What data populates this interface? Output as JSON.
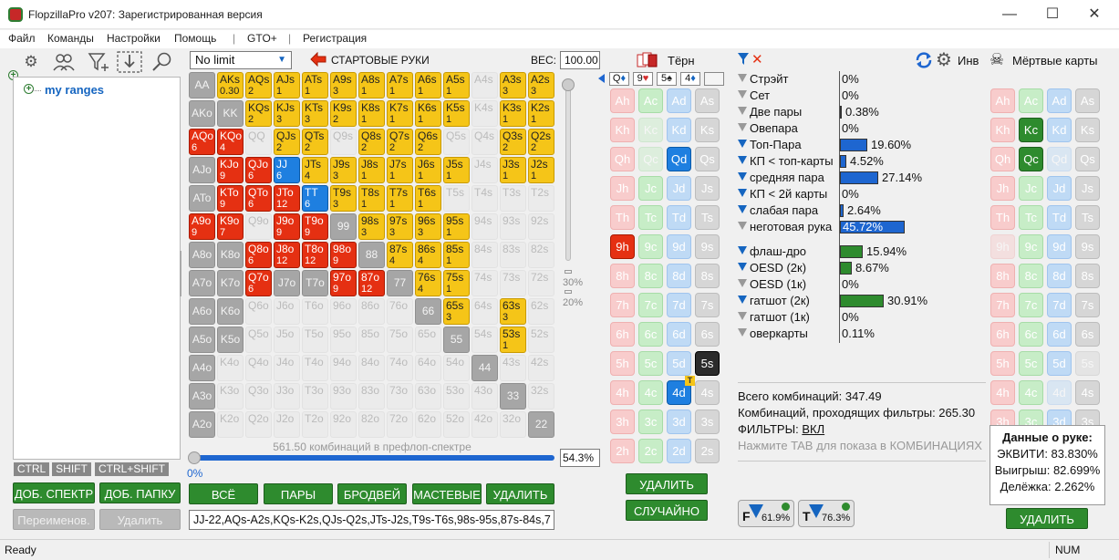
{
  "window": {
    "title": "FlopzillaPro v207: Зарегистрированная версия",
    "minimize_glyph": "—",
    "maximize_glyph": "☐",
    "close_glyph": "✕"
  },
  "menu": [
    "Файл",
    "Команды",
    "Настройки",
    "Помощь",
    "|",
    "GTO+",
    "|",
    "Регистрация"
  ],
  "left": {
    "tree_root": "my ranges",
    "key_buttons": [
      "CTRL",
      "SHIFT",
      "CTRL+SHIFT"
    ],
    "buttons": [
      "ДОБ. СПЕКТР",
      "ДОБ. ПАПКУ",
      "Переименов.",
      "Удалить"
    ]
  },
  "center": {
    "game_type": "No limit",
    "starting_hands_label": "СТАРТОВЫЕ РУКИ",
    "weight_label": "ВЕС:",
    "weight_value": "100.00",
    "slider_marks": [
      "30%",
      "20%"
    ],
    "combos_status": "561.50 комбинаций в префлоп-спектре",
    "range_percent": "54.3%",
    "slider_min": "0%",
    "buttons": [
      "ВСЁ",
      "ПАРЫ",
      "БРОДВЕЙ",
      "МАСТЕВЫЕ",
      "УДАЛИТЬ"
    ],
    "range_text": "JJ-22,AQs-A2s,KQs-K2s,QJs-Q2s,JTs-J2s,T9s-T6s,98s-95s,87s-84s,7",
    "grid": [
      [
        [
          "AA",
          "",
          "p"
        ],
        [
          "AKs",
          "0.30",
          "y"
        ],
        [
          "AQs",
          "2",
          "y"
        ],
        [
          "AJs",
          "1",
          "y"
        ],
        [
          "ATs",
          "1",
          "y"
        ],
        [
          "A9s",
          "3",
          "y"
        ],
        [
          "A8s",
          "1",
          "y"
        ],
        [
          "A7s",
          "1",
          "y"
        ],
        [
          "A6s",
          "1",
          "y"
        ],
        [
          "A5s",
          "1",
          "y"
        ],
        [
          "A4s",
          "",
          "e"
        ],
        [
          "A3s",
          "3",
          "y"
        ],
        [
          "A2s",
          "3",
          "y"
        ]
      ],
      [
        [
          "AKo",
          "",
          "p"
        ],
        [
          "KK",
          "",
          "p"
        ],
        [
          "KQs",
          "2",
          "y"
        ],
        [
          "KJs",
          "3",
          "y"
        ],
        [
          "KTs",
          "3",
          "y"
        ],
        [
          "K9s",
          "2",
          "y"
        ],
        [
          "K8s",
          "1",
          "y"
        ],
        [
          "K7s",
          "1",
          "y"
        ],
        [
          "K6s",
          "1",
          "y"
        ],
        [
          "K5s",
          "1",
          "y"
        ],
        [
          "K4s",
          "",
          "e"
        ],
        [
          "K3s",
          "1",
          "y"
        ],
        [
          "K2s",
          "1",
          "y"
        ]
      ],
      [
        [
          "AQo",
          "6",
          "r"
        ],
        [
          "KQo",
          "4",
          "r"
        ],
        [
          "QQ",
          "",
          "e"
        ],
        [
          "QJs",
          "2",
          "y"
        ],
        [
          "QTs",
          "2",
          "y"
        ],
        [
          "Q9s",
          "",
          "e"
        ],
        [
          "Q8s",
          "2",
          "y"
        ],
        [
          "Q7s",
          "2",
          "y"
        ],
        [
          "Q6s",
          "2",
          "y"
        ],
        [
          "Q5s",
          "",
          "e"
        ],
        [
          "Q4s",
          "",
          "e"
        ],
        [
          "Q3s",
          "2",
          "y"
        ],
        [
          "Q2s",
          "2",
          "y"
        ]
      ],
      [
        [
          "AJo",
          "",
          "p"
        ],
        [
          "KJo",
          "9",
          "r"
        ],
        [
          "QJo",
          "6",
          "r"
        ],
        [
          "JJ",
          "6",
          "b"
        ],
        [
          "JTs",
          "4",
          "y"
        ],
        [
          "J9s",
          "3",
          "y"
        ],
        [
          "J8s",
          "1",
          "y"
        ],
        [
          "J7s",
          "1",
          "y"
        ],
        [
          "J6s",
          "1",
          "y"
        ],
        [
          "J5s",
          "1",
          "y"
        ],
        [
          "J4s",
          "",
          "e"
        ],
        [
          "J3s",
          "1",
          "y"
        ],
        [
          "J2s",
          "1",
          "y"
        ]
      ],
      [
        [
          "ATo",
          "",
          "p"
        ],
        [
          "KTo",
          "9",
          "r"
        ],
        [
          "QTo",
          "6",
          "r"
        ],
        [
          "JTo",
          "12",
          "r"
        ],
        [
          "TT",
          "6",
          "b"
        ],
        [
          "T9s",
          "3",
          "y"
        ],
        [
          "T8s",
          "1",
          "y"
        ],
        [
          "T7s",
          "1",
          "y"
        ],
        [
          "T6s",
          "1",
          "y"
        ],
        [
          "T5s",
          "",
          "e"
        ],
        [
          "T4s",
          "",
          "e"
        ],
        [
          "T3s",
          "",
          "e"
        ],
        [
          "T2s",
          "",
          "e"
        ]
      ],
      [
        [
          "A9o",
          "9",
          "r"
        ],
        [
          "K9o",
          "7",
          "r"
        ],
        [
          "Q9o",
          "",
          "e"
        ],
        [
          "J9o",
          "9",
          "r"
        ],
        [
          "T9o",
          "9",
          "r"
        ],
        [
          "99",
          "",
          "p"
        ],
        [
          "98s",
          "3",
          "y"
        ],
        [
          "97s",
          "3",
          "y"
        ],
        [
          "96s",
          "3",
          "y"
        ],
        [
          "95s",
          "1",
          "y"
        ],
        [
          "94s",
          "",
          "e"
        ],
        [
          "93s",
          "",
          "e"
        ],
        [
          "92s",
          "",
          "e"
        ]
      ],
      [
        [
          "A8o",
          "",
          "p"
        ],
        [
          "K8o",
          "",
          "p"
        ],
        [
          "Q8o",
          "6",
          "r"
        ],
        [
          "J8o",
          "12",
          "r"
        ],
        [
          "T8o",
          "12",
          "r"
        ],
        [
          "98o",
          "9",
          "r"
        ],
        [
          "88",
          "",
          "p"
        ],
        [
          "87s",
          "4",
          "y"
        ],
        [
          "86s",
          "4",
          "y"
        ],
        [
          "85s",
          "1",
          "y"
        ],
        [
          "84s",
          "",
          "e"
        ],
        [
          "83s",
          "",
          "e"
        ],
        [
          "82s",
          "",
          "e"
        ]
      ],
      [
        [
          "A7o",
          "",
          "p"
        ],
        [
          "K7o",
          "",
          "p"
        ],
        [
          "Q7o",
          "6",
          "r"
        ],
        [
          "J7o",
          "",
          "p"
        ],
        [
          "T7o",
          "",
          "p"
        ],
        [
          "97o",
          "9",
          "r"
        ],
        [
          "87o",
          "12",
          "r"
        ],
        [
          "77",
          "",
          "p"
        ],
        [
          "76s",
          "4",
          "y"
        ],
        [
          "75s",
          "1",
          "y"
        ],
        [
          "74s",
          "",
          "e"
        ],
        [
          "73s",
          "",
          "e"
        ],
        [
          "72s",
          "",
          "e"
        ]
      ],
      [
        [
          "A6o",
          "",
          "p"
        ],
        [
          "K6o",
          "",
          "p"
        ],
        [
          "Q6o",
          "",
          "e"
        ],
        [
          "J6o",
          "",
          "e"
        ],
        [
          "T6o",
          "",
          "e"
        ],
        [
          "96o",
          "",
          "e"
        ],
        [
          "86o",
          "",
          "e"
        ],
        [
          "76o",
          "",
          "e"
        ],
        [
          "66",
          "",
          "p"
        ],
        [
          "65s",
          "3",
          "y"
        ],
        [
          "64s",
          "",
          "e"
        ],
        [
          "63s",
          "3",
          "y"
        ],
        [
          "62s",
          "",
          "e"
        ]
      ],
      [
        [
          "A5o",
          "",
          "p"
        ],
        [
          "K5o",
          "",
          "p"
        ],
        [
          "Q5o",
          "",
          "e"
        ],
        [
          "J5o",
          "",
          "e"
        ],
        [
          "T5o",
          "",
          "e"
        ],
        [
          "95o",
          "",
          "e"
        ],
        [
          "85o",
          "",
          "e"
        ],
        [
          "75o",
          "",
          "e"
        ],
        [
          "65o",
          "",
          "e"
        ],
        [
          "55",
          "",
          "p"
        ],
        [
          "54s",
          "",
          "e"
        ],
        [
          "53s",
          "1",
          "y"
        ],
        [
          "52s",
          "",
          "e"
        ]
      ],
      [
        [
          "A4o",
          "",
          "p"
        ],
        [
          "K4o",
          "",
          "e"
        ],
        [
          "Q4o",
          "",
          "e"
        ],
        [
          "J4o",
          "",
          "e"
        ],
        [
          "T4o",
          "",
          "e"
        ],
        [
          "94o",
          "",
          "e"
        ],
        [
          "84o",
          "",
          "e"
        ],
        [
          "74o",
          "",
          "e"
        ],
        [
          "64o",
          "",
          "e"
        ],
        [
          "54o",
          "",
          "e"
        ],
        [
          "44",
          "",
          "p"
        ],
        [
          "43s",
          "",
          "e"
        ],
        [
          "42s",
          "",
          "e"
        ]
      ],
      [
        [
          "A3o",
          "",
          "p"
        ],
        [
          "K3o",
          "",
          "e"
        ],
        [
          "Q3o",
          "",
          "e"
        ],
        [
          "J3o",
          "",
          "e"
        ],
        [
          "T3o",
          "",
          "e"
        ],
        [
          "93o",
          "",
          "e"
        ],
        [
          "83o",
          "",
          "e"
        ],
        [
          "73o",
          "",
          "e"
        ],
        [
          "63o",
          "",
          "e"
        ],
        [
          "53o",
          "",
          "e"
        ],
        [
          "43o",
          "",
          "e"
        ],
        [
          "33",
          "",
          "p"
        ],
        [
          "32s",
          "",
          "e"
        ]
      ],
      [
        [
          "A2o",
          "",
          "p"
        ],
        [
          "K2o",
          "",
          "e"
        ],
        [
          "Q2o",
          "",
          "e"
        ],
        [
          "J2o",
          "",
          "e"
        ],
        [
          "T2o",
          "",
          "e"
        ],
        [
          "92o",
          "",
          "e"
        ],
        [
          "82o",
          "",
          "e"
        ],
        [
          "72o",
          "",
          "e"
        ],
        [
          "62o",
          "",
          "e"
        ],
        [
          "52o",
          "",
          "e"
        ],
        [
          "42o",
          "",
          "e"
        ],
        [
          "32o",
          "",
          "e"
        ],
        [
          "22",
          "",
          "p"
        ]
      ]
    ]
  },
  "board": {
    "title": "Тёрн",
    "slots": [
      {
        "rank": "Q",
        "suit": "♦",
        "color": "#1565c0"
      },
      {
        "rank": "9",
        "suit": "♥",
        "color": "#d32f2f"
      },
      {
        "rank": "5",
        "suit": "♠",
        "color": "#222222"
      },
      {
        "rank": "4",
        "suit": "♦",
        "color": "#1565c0"
      }
    ],
    "ranks": [
      "A",
      "K",
      "Q",
      "J",
      "T",
      "9",
      "8",
      "7",
      "6",
      "5",
      "4",
      "3",
      "2"
    ],
    "suit_letters": [
      "h",
      "c",
      "d",
      "s"
    ],
    "selected": [
      "Qd",
      "9h",
      "5s",
      "4d"
    ],
    "hidden": [
      "Kc",
      "Qc"
    ],
    "turn_badge": "T",
    "buttons": [
      "УДАЛИТЬ",
      "СЛУЧАЙНО"
    ]
  },
  "stats": {
    "inv_label": "Инв",
    "rows": [
      {
        "label": "Стрэйт",
        "value": "0%",
        "pct": 0,
        "color": "#1e66d0",
        "on": false
      },
      {
        "label": "Сет",
        "value": "0%",
        "pct": 0,
        "color": "#1e66d0",
        "on": false
      },
      {
        "label": "Две пары",
        "value": "0.38%",
        "pct": 0.38,
        "color": "#1e66d0",
        "on": false
      },
      {
        "label": "Овепара",
        "value": "0%",
        "pct": 0,
        "color": "#1e66d0",
        "on": false
      },
      {
        "label": "Топ-Пара",
        "value": "19.60%",
        "pct": 19.6,
        "color": "#1e66d0",
        "on": true
      },
      {
        "label": "КП < топ-карты",
        "value": "4.52%",
        "pct": 4.52,
        "color": "#1e66d0",
        "on": true
      },
      {
        "label": "средняя пара",
        "value": "27.14%",
        "pct": 27.14,
        "color": "#1e66d0",
        "on": true
      },
      {
        "label": "КП < 2й карты",
        "value": "0%",
        "pct": 0,
        "color": "#1e66d0",
        "on": true
      },
      {
        "label": "слабая пара",
        "value": "2.64%",
        "pct": 2.64,
        "color": "#1e66d0",
        "on": true
      },
      {
        "label": "неготовая рука",
        "value": "45.72%",
        "pct": 45.72,
        "color": "#1e66d0",
        "on": false
      },
      {
        "label": "флаш-дро",
        "value": "15.94%",
        "pct": 15.94,
        "color": "#2e8b2e",
        "on": true
      },
      {
        "label": "OESD (2к)",
        "value": "8.67%",
        "pct": 8.67,
        "color": "#2e8b2e",
        "on": true
      },
      {
        "label": "OESD (1к)",
        "value": "0%",
        "pct": 0,
        "color": "#2e8b2e",
        "on": false
      },
      {
        "label": "гатшот (2к)",
        "value": "30.91%",
        "pct": 30.91,
        "color": "#2e8b2e",
        "on": true
      },
      {
        "label": "гатшот (1к)",
        "value": "0%",
        "pct": 0,
        "color": "#2e8b2e",
        "on": false
      },
      {
        "label": "оверкарты",
        "value": "0.11%",
        "pct": 0.11,
        "color": "#2e8b2e",
        "on": false
      }
    ],
    "total_combos": "Всего комбинаций: 347.49",
    "filtered_combos": "Комбинаций, проходящих фильтры: 265.30",
    "filters_label": "ФИЛЬТРЫ:",
    "filters_value": "ВКЛ",
    "tab_hint": "Нажмите TAB для показа в КОМБИНАЦИЯХ",
    "filter_f": {
      "letter": "F",
      "pct": "61.9%"
    },
    "filter_t": {
      "letter": "T",
      "pct": "76.3%"
    }
  },
  "dead": {
    "title": "Мёртвые карты",
    "ranks": [
      "A",
      "K",
      "Q",
      "J",
      "T",
      "9",
      "8",
      "7",
      "6",
      "5",
      "4",
      "3",
      "2"
    ],
    "selected": [
      "Kc",
      "Qc"
    ],
    "off": [
      "Qd",
      "9h",
      "5s",
      "4d"
    ],
    "hand_data": {
      "title": "Данные о руке:",
      "equity": "ЭКВИТИ: 83.830%",
      "win": "Выигрыш: 82.699%",
      "tie": "Делёжка: 2.262%"
    },
    "delete_button": "УДАЛИТЬ"
  },
  "statusbar": {
    "left": "Ready",
    "right": "NUM"
  }
}
